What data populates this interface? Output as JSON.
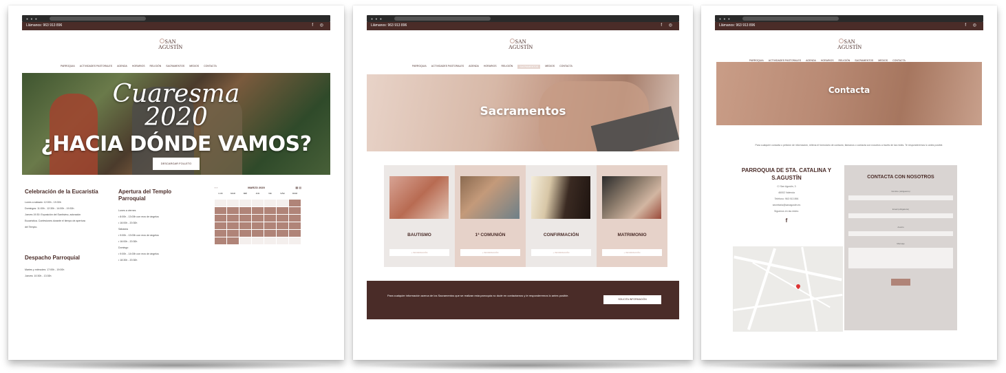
{
  "common": {
    "phone": "Llámanos: 963 913 896",
    "brand": "SAN AGUSTÍN",
    "brand_top": "SAN",
    "brand_bottom": "AGUSTÍN",
    "social": "f ◎"
  },
  "card1": {
    "nav": [
      "PARROQUIA",
      "ACTIVIDADES PASTORALES",
      "AGENDA",
      "HORARIOS",
      "RELIGIÓN",
      "SACRAMENTOS",
      "MEDIOS",
      "CONTACTA"
    ],
    "hero_script_1": "Cuaresma",
    "hero_script_2": "2020",
    "hero_big": "¿HACIA DÓNDE VAMOS?",
    "hero_button": "DESCARGAR FOLLETO",
    "eucaristia_title": "Celebración de la Eucaristía",
    "eucaristia_lines": [
      "Lunes a sábado: 12:00h - 19:30h",
      "Domingos: 11:00h - 12:30h - 14:00h - 19:30h",
      "Jueves 19:30: Exposición del Santísimo, adoración",
      "Eucarística. Confesiones durante el tiempo de apertura",
      "del Templo."
    ],
    "despacho_title": "Despacho Parroquial",
    "despacho_lines": [
      "Martes y miércoles: 17:00h - 19:00h",
      "Jueves: 10:30h - 13:30h"
    ],
    "apertura_title": "Apertura del Templo Parroquial",
    "apertura_lines": [
      "Lunes a viernes",
      "• 8:00h - 13:00h con rezo de ángelus",
      "• 16:00h - 20:30h",
      "Sábados",
      "• 9:00h - 13:00h con rezo de ángelus",
      "• 16:00h - 20:30h",
      "Domingo",
      "• 9:00h - 14:00h con rezo de ángelus",
      "• 18:30h - 20:30h"
    ],
    "calendar_month": "MARZO 2020",
    "calendar_days": [
      "LUN",
      "MAR",
      "MIÉ",
      "JUE",
      "VIE",
      "SÁB",
      "DOM"
    ]
  },
  "card2": {
    "nav": [
      "PARROQUIA",
      "ACTIVIDADES PASTORALES",
      "AGENDA",
      "HORARIOS",
      "RELIGIÓN",
      "SACRAMENTOS",
      "MEDIOS",
      "CONTACTA"
    ],
    "nav_active": "SACRAMENTOS",
    "hero_title": "Sacramentos",
    "sacraments": [
      {
        "label": "BAUTISMO",
        "sub": "+ INFORMACIÓN"
      },
      {
        "label": "1ª COMUNIÓN",
        "sub": "+ INFORMACIÓN"
      },
      {
        "label": "CONFIRMACIÓN",
        "sub": "+ INFORMACIÓN"
      },
      {
        "label": "MATRIMONIO",
        "sub": "+ INFORMACIÓN"
      }
    ],
    "band_text": "Para cualquier información acerca de los Sacramentos que se realizan esta parroquia no dude en contactarnos y le responderemos lo antes posible.",
    "band_button": "SOLICITA INFORMACIÓN"
  },
  "card3": {
    "nav": [
      "PARROQUIA",
      "ACTIVIDADES PASTORALES",
      "AGENDA",
      "HORARIOS",
      "RELIGIÓN",
      "SACRAMENTOS",
      "MEDIOS",
      "CONTACTA"
    ],
    "hero_title": "Contacta",
    "intro": "Para cualquier consulta o petición de información, rellena el formulario de contacto, llámanos o contacta con nosotros a través de las redes. Te responderemos lo antes posible.",
    "parish_title": "PARROQUIA DE STA. CATALINA Y S.AGUSTÍN",
    "parish_lines": [
      "C/ San Agustín, 3",
      "46002 Valencia",
      "Teléfono: 963 913 896",
      "secretaria@sanagustin.es",
      "Síguenos en las redes:"
    ],
    "facebook": "f",
    "form_title": "CONTACTA CON NOSOTROS",
    "form_fields": [
      "Nombre (obligatorio)",
      "Email (obligatorio)",
      "Asunto",
      "Mensaje"
    ]
  }
}
